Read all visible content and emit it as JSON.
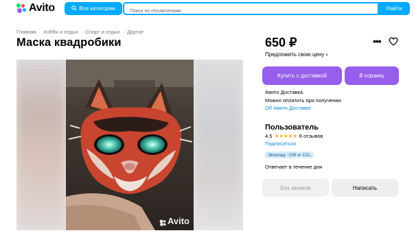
{
  "header": {
    "logo_text": "Avito",
    "categories_label": "Все категории",
    "search_placeholder": "Поиск по объявлениям",
    "search_button": "Найти"
  },
  "breadcrumbs": [
    "Главная",
    "Хобби и отдых",
    "Спорт и отдых",
    "Другое"
  ],
  "breadcrumb_separator": "·",
  "listing": {
    "title": "Маска квадробики",
    "price": "650 ₽",
    "offer_price": "Предложить свою цену",
    "offer_arrow": "›",
    "watermark": "Avito"
  },
  "actions": {
    "more": "•••",
    "buy_delivery": "Купить с доставкой",
    "to_cart": "В корзину",
    "no_calls": "Без звонков",
    "write": "Написать"
  },
  "delivery": {
    "line1": "Авито Доставка.",
    "line2": "Можно оплатить при получении",
    "link": "Об Авито Доставке"
  },
  "seller": {
    "name": "Пользователь",
    "rating": "4.5",
    "stars": "★★★★★",
    "reviews": "8 отзывов",
    "subscribe": "Подписаться",
    "eco_badge": "Экоклад −236 кг CO₂",
    "response_time": "Отвечает в течение дня"
  },
  "colors": {
    "accent_blue": "#00aaff",
    "purple": "#965eeb",
    "link": "#0a8ad8",
    "star": "#ffb021"
  },
  "icons": [
    "avito-logo-icon",
    "search-icon",
    "more-icon",
    "heart-icon",
    "chevron-right-icon"
  ]
}
